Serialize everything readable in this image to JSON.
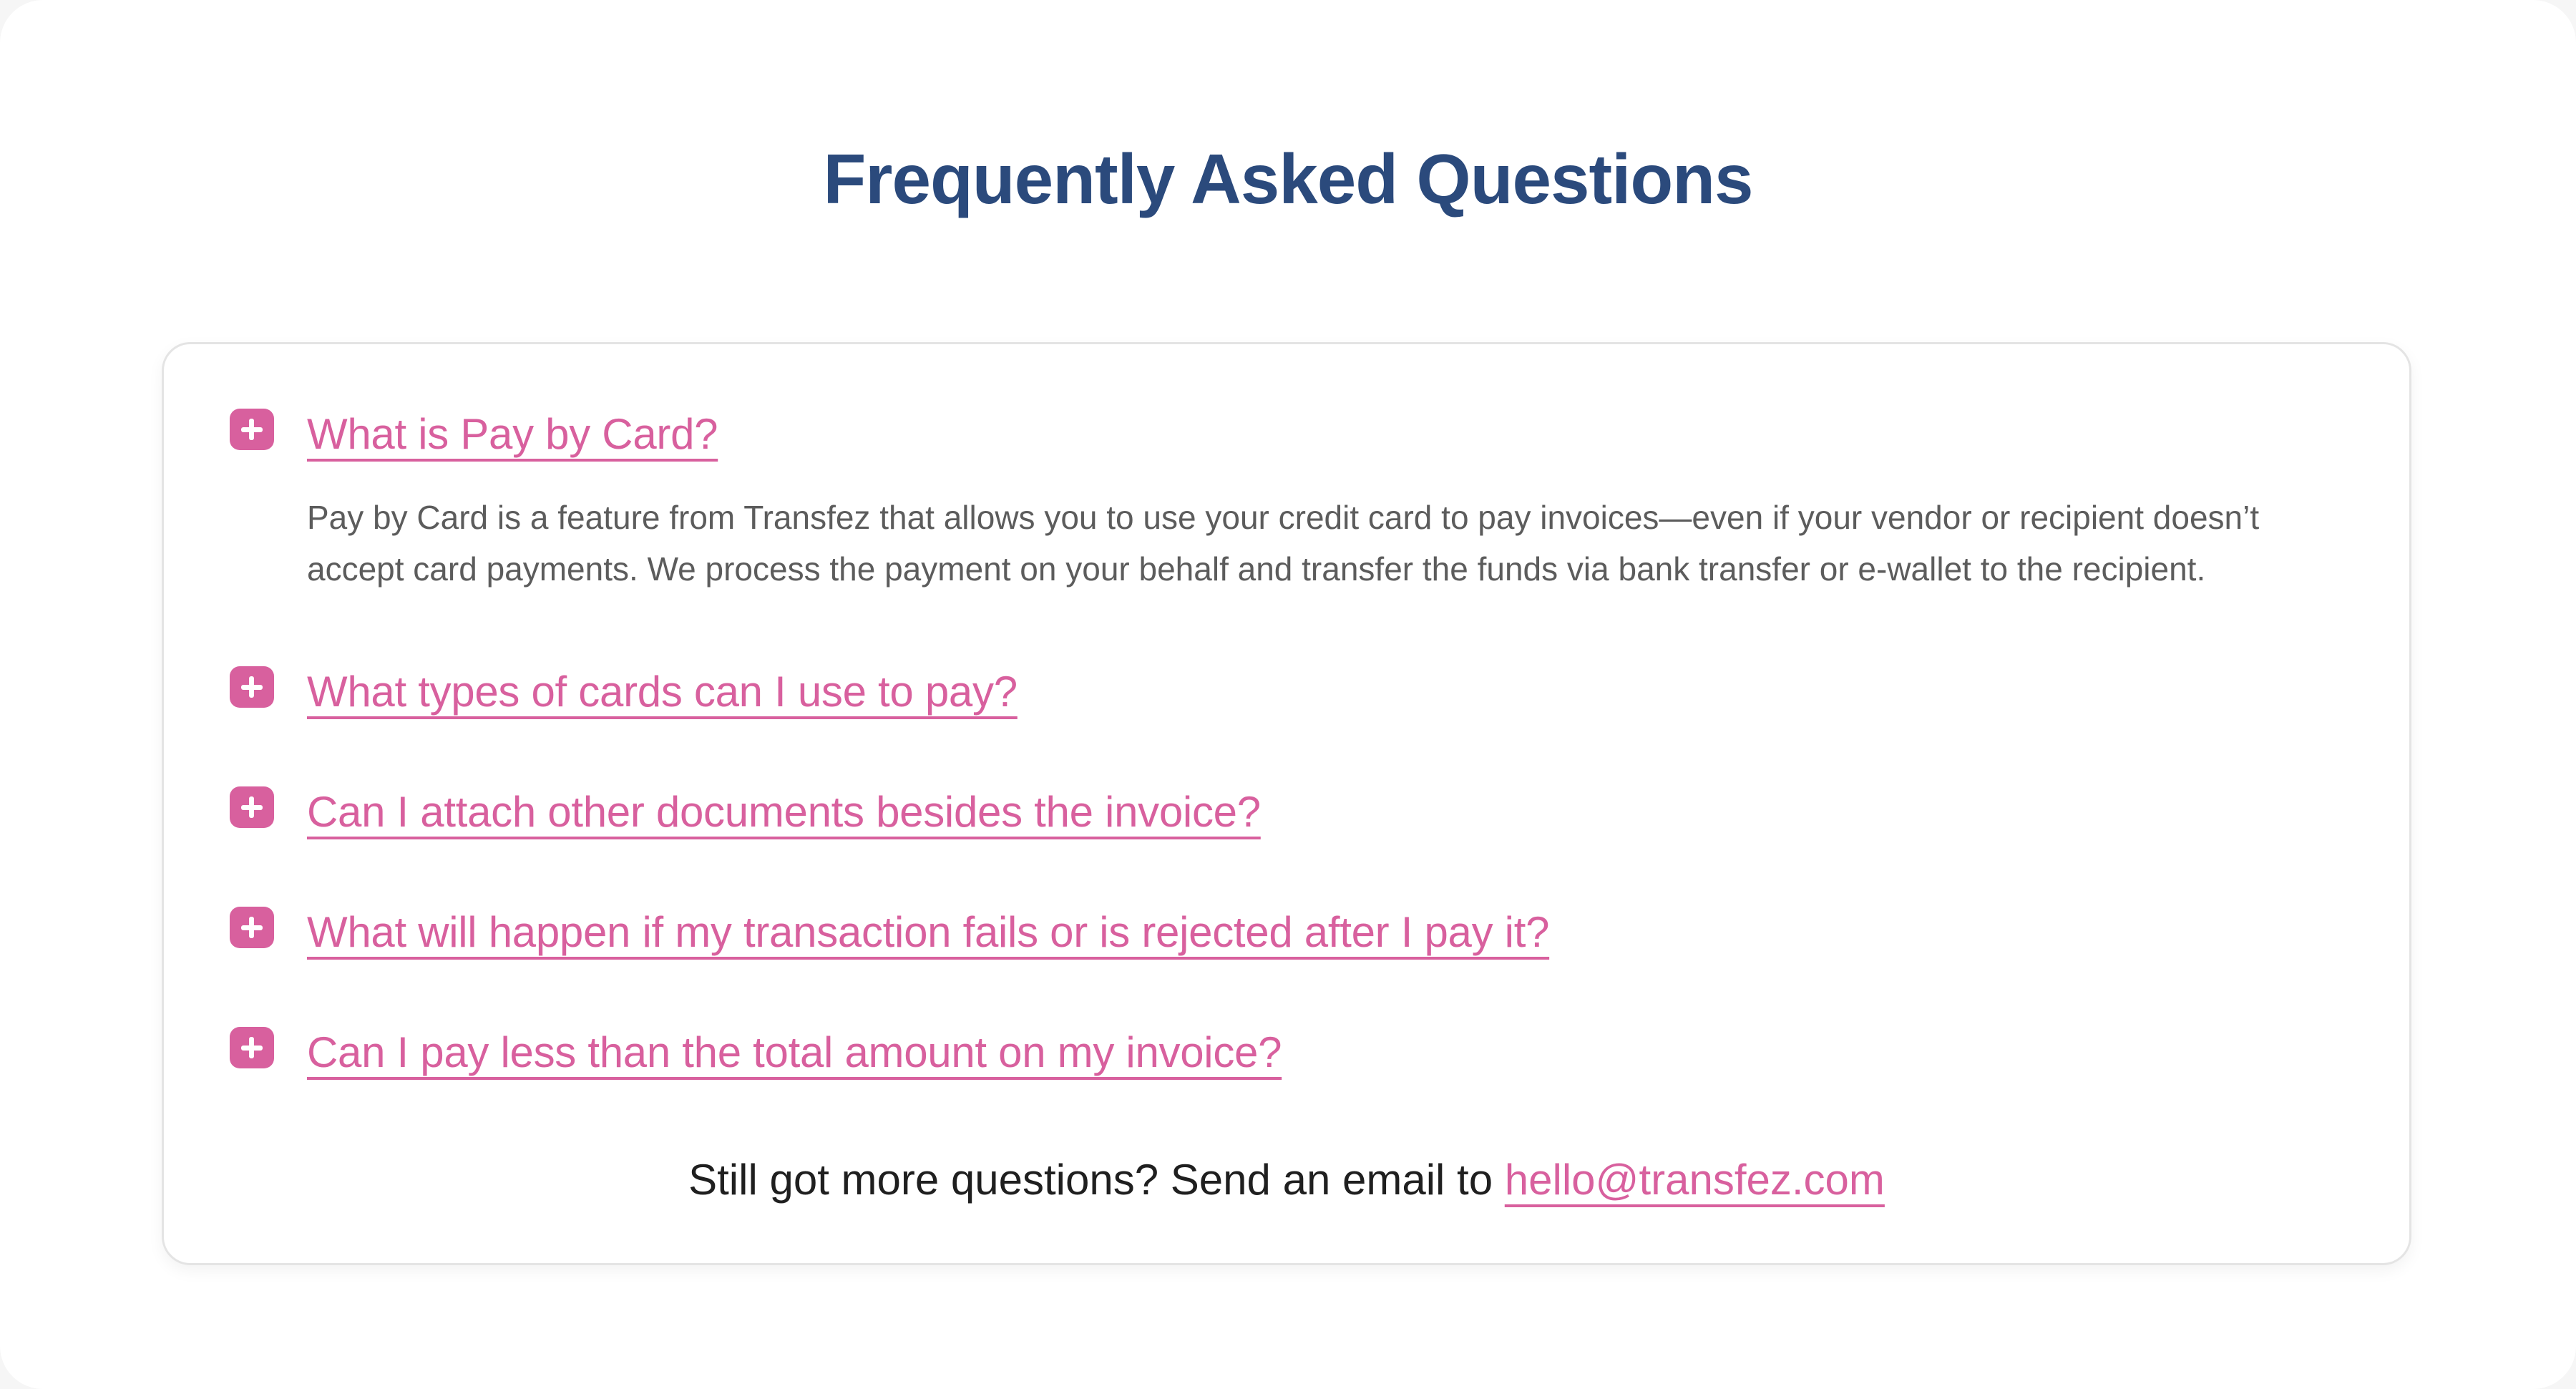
{
  "colors": {
    "title": "#2b4a7c",
    "accent": "#d8609e",
    "answer_text": "#5c5c5c",
    "footer_text": "#1f1f1f"
  },
  "faq": {
    "title": "Frequently Asked Questions",
    "items": [
      {
        "icon": "plus-icon",
        "question": "What is Pay by Card?",
        "answer": "Pay by Card is a feature from Transfez that allows you to use your credit card to pay invoices—even if your vendor or recipient doesn’t accept card payments. We process the payment on your behalf and transfer the funds via bank transfer or e-wallet to the recipient."
      },
      {
        "icon": "plus-icon",
        "question": "What types of cards can I use to pay?"
      },
      {
        "icon": "plus-icon",
        "question": "Can I attach other documents besides the invoice?"
      },
      {
        "icon": "plus-icon",
        "question": "What will happen if my transaction fails or is rejected after I pay it?"
      },
      {
        "icon": "plus-icon",
        "question": "Can I pay less than the total amount on my invoice?"
      }
    ],
    "footer": {
      "text": "Still got more questions? Send an email to ",
      "email": "hello@transfez.com"
    }
  }
}
